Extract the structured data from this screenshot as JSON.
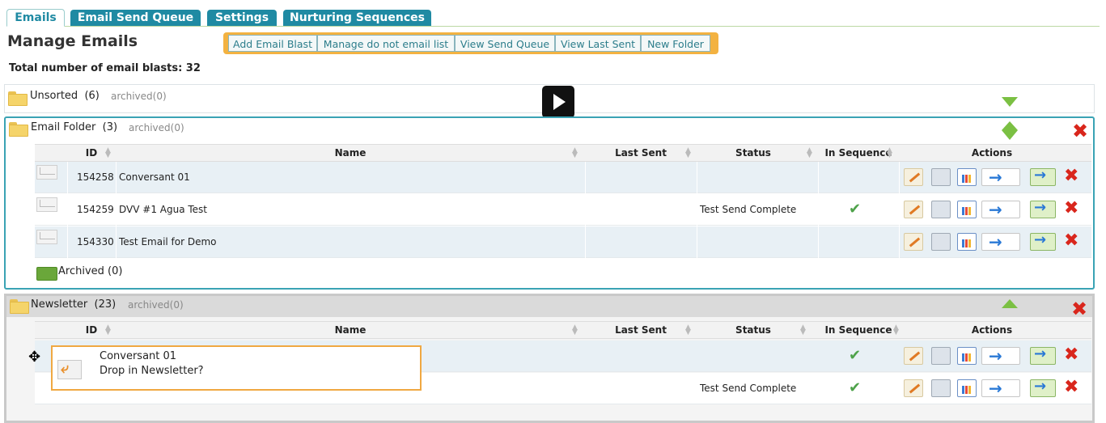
{
  "tabs": [
    {
      "label": "Emails",
      "active": true
    },
    {
      "label": "Email Send Queue",
      "active": false
    },
    {
      "label": "Settings",
      "active": false
    },
    {
      "label": "Nurturing Sequences",
      "active": false
    }
  ],
  "page_title": "Manage Emails",
  "total_label": "Total number of email blasts: 32",
  "toolbar": [
    "Add Email Blast",
    "Manage do not email list",
    "View Send Queue",
    "View Last Sent",
    "New Folder"
  ],
  "columns": [
    "ID",
    "Name",
    "Last Sent",
    "Status",
    "In Sequence",
    "Actions"
  ],
  "folders": {
    "unsorted": {
      "name": "Unsorted",
      "count": "(6)",
      "archived": "archived(0)"
    },
    "email_folder": {
      "name": "Email Folder",
      "count": "(3)",
      "archived": "archived(0)",
      "rows": [
        {
          "id": "154258",
          "name": "Conversant 01",
          "last_sent": "",
          "status": "",
          "in_sequence": false
        },
        {
          "id": "154259",
          "name": "DVV #1 Agua Test",
          "last_sent": "",
          "status": "Test Send Complete",
          "in_sequence": true
        },
        {
          "id": "154330",
          "name": "Test Email for Demo",
          "last_sent": "",
          "status": "",
          "in_sequence": false
        }
      ],
      "archived_footer": "Archived (0)"
    },
    "newsletter": {
      "name": "Newsletter",
      "count": "(23)",
      "archived": "archived(0)",
      "rows": [
        {
          "id": "",
          "name": "",
          "last_sent": "",
          "status": "",
          "in_sequence": true
        },
        {
          "id": "",
          "name": "",
          "last_sent": "",
          "status": "Test Send Complete",
          "in_sequence": true
        }
      ]
    }
  },
  "drag_tooltip": {
    "line1": "Conversant 01",
    "line2": "Drop in Newsletter?"
  },
  "colors": {
    "tab": "#1f8aa3",
    "toolbar_border": "#f3b241",
    "folder_border": "#3aa3b4",
    "delete": "#d9261c",
    "check": "#4ea24a"
  }
}
